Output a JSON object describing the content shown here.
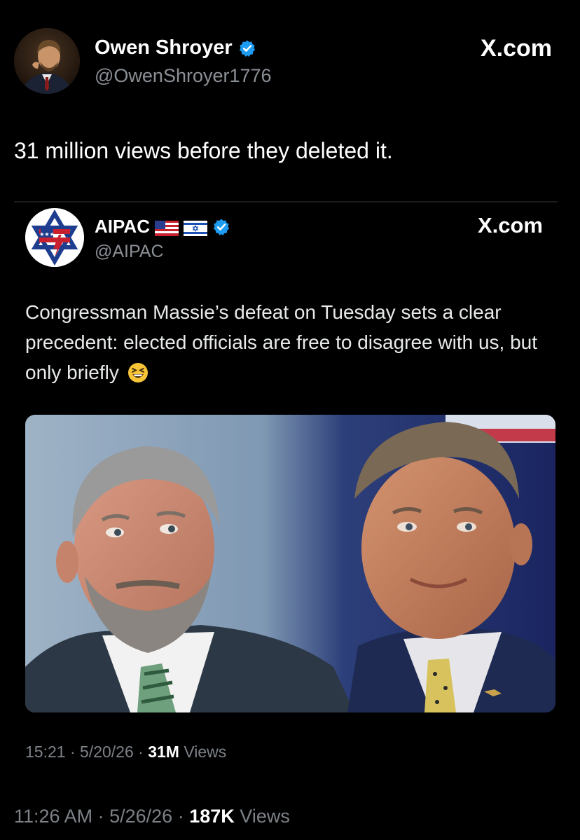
{
  "outer_tweet": {
    "author_name": "Owen Shroyer",
    "handle": "@OwenShroyer1776",
    "site": "X.com",
    "text": "31 million views before they deleted it.",
    "time": "11:26 AM",
    "date": "5/26/26",
    "views_count": "187K",
    "views_label": "Views",
    "separator": "·"
  },
  "quoted_tweet": {
    "author_name": "AIPAC",
    "handle": "@AIPAC",
    "site": "X.com",
    "text": "Congressman Massie’s defeat on Tuesday sets a clear precedent: elected officials are free to disagree with us, but only briefly",
    "time": "15:21",
    "date": "5/20/26",
    "views_count": "31M",
    "views_label": "Views",
    "separator": "·",
    "emoji": "grinning-squinting-face"
  },
  "icons": {
    "verified": "verified-badge-icon",
    "flags": [
      "us-flag-icon",
      "israel-flag-icon"
    ]
  },
  "colors": {
    "background": "#000000",
    "text_primary": "#ffffff",
    "text_secondary": "#8b9096",
    "verified_blue": "#1d9bf0"
  }
}
